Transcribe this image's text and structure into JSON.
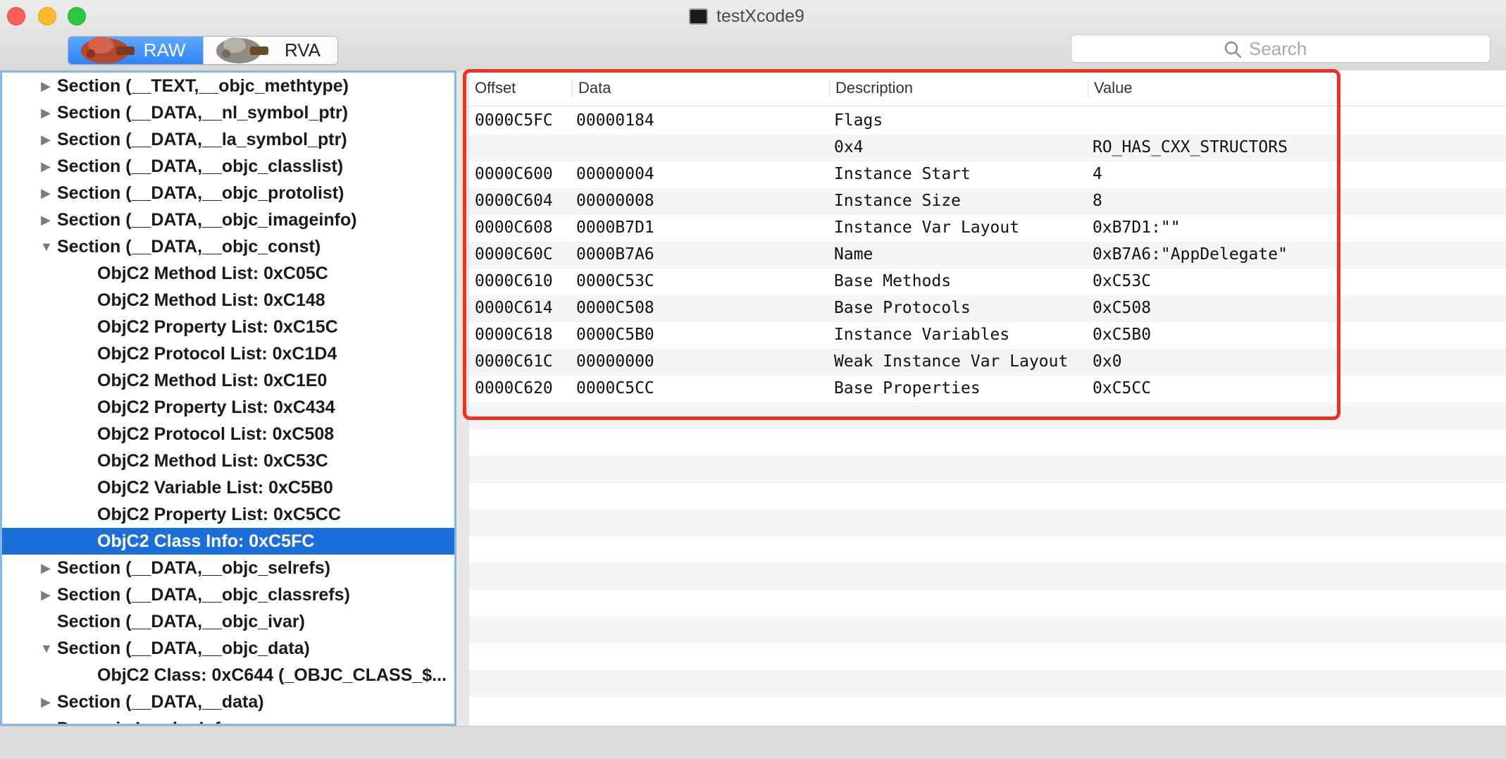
{
  "window": {
    "title": "testXcode9"
  },
  "toolbar": {
    "raw_label": "RAW",
    "rva_label": "RVA",
    "search_placeholder": "Search"
  },
  "tree": [
    {
      "label": "Section (__TEXT,__objc_methtype)",
      "disclosure": "collapsed",
      "level": 0
    },
    {
      "label": "Section (__DATA,__nl_symbol_ptr)",
      "disclosure": "collapsed",
      "level": 0
    },
    {
      "label": "Section (__DATA,__la_symbol_ptr)",
      "disclosure": "collapsed",
      "level": 0
    },
    {
      "label": "Section (__DATA,__objc_classlist)",
      "disclosure": "collapsed",
      "level": 0
    },
    {
      "label": "Section (__DATA,__objc_protolist)",
      "disclosure": "collapsed",
      "level": 0
    },
    {
      "label": "Section (__DATA,__objc_imageinfo)",
      "disclosure": "collapsed",
      "level": 0
    },
    {
      "label": "Section (__DATA,__objc_const)",
      "disclosure": "expanded",
      "level": 0
    },
    {
      "label": "ObjC2 Method List: 0xC05C",
      "disclosure": "none",
      "level": 1
    },
    {
      "label": "ObjC2 Method List: 0xC148",
      "disclosure": "none",
      "level": 1
    },
    {
      "label": "ObjC2 Property List: 0xC15C",
      "disclosure": "none",
      "level": 1
    },
    {
      "label": "ObjC2 Protocol List: 0xC1D4",
      "disclosure": "none",
      "level": 1
    },
    {
      "label": "ObjC2 Method List: 0xC1E0",
      "disclosure": "none",
      "level": 1
    },
    {
      "label": "ObjC2 Property List: 0xC434",
      "disclosure": "none",
      "level": 1
    },
    {
      "label": "ObjC2 Protocol List: 0xC508",
      "disclosure": "none",
      "level": 1
    },
    {
      "label": "ObjC2 Method List: 0xC53C",
      "disclosure": "none",
      "level": 1
    },
    {
      "label": "ObjC2 Variable List: 0xC5B0",
      "disclosure": "none",
      "level": 1
    },
    {
      "label": "ObjC2 Property List: 0xC5CC",
      "disclosure": "none",
      "level": 1
    },
    {
      "label": "ObjC2 Class Info: 0xC5FC",
      "disclosure": "none",
      "level": 1,
      "selected": true
    },
    {
      "label": "Section (__DATA,__objc_selrefs)",
      "disclosure": "collapsed",
      "level": 0
    },
    {
      "label": "Section (__DATA,__objc_classrefs)",
      "disclosure": "collapsed",
      "level": 0
    },
    {
      "label": "Section (__DATA,__objc_ivar)",
      "disclosure": "none",
      "level": 0
    },
    {
      "label": "Section (__DATA,__objc_data)",
      "disclosure": "expanded",
      "level": 0
    },
    {
      "label": "ObjC2 Class: 0xC644 (_OBJC_CLASS_$...",
      "disclosure": "none",
      "level": 1
    },
    {
      "label": "Section (__DATA,__data)",
      "disclosure": "collapsed",
      "level": 0
    },
    {
      "label": "Dynamic Loader Info",
      "disclosure": "collapsed",
      "level": 0
    }
  ],
  "table": {
    "columns": [
      "Offset",
      "Data",
      "Description",
      "Value"
    ],
    "rows": [
      {
        "offset": "0000C5FC",
        "data": "00000184",
        "description": "Flags",
        "value": ""
      },
      {
        "offset": "",
        "data": "",
        "description": "0x4",
        "value": "RO_HAS_CXX_STRUCTORS"
      },
      {
        "offset": "0000C600",
        "data": "00000004",
        "description": "Instance Start",
        "value": "4"
      },
      {
        "offset": "0000C604",
        "data": "00000008",
        "description": "Instance Size",
        "value": "8"
      },
      {
        "offset": "0000C608",
        "data": "0000B7D1",
        "description": "Instance Var Layout",
        "value": "0xB7D1:\"\""
      },
      {
        "offset": "0000C60C",
        "data": "0000B7A6",
        "description": "Name",
        "value": "0xB7A6:\"AppDelegate\""
      },
      {
        "offset": "0000C610",
        "data": "0000C53C",
        "description": "Base Methods",
        "value": "0xC53C"
      },
      {
        "offset": "0000C614",
        "data": "0000C508",
        "description": "Base Protocols",
        "value": "0xC508"
      },
      {
        "offset": "0000C618",
        "data": "0000C5B0",
        "description": "Instance Variables",
        "value": "0xC5B0"
      },
      {
        "offset": "0000C61C",
        "data": "00000000",
        "description": "Weak Instance Var Layout",
        "value": "0x0"
      },
      {
        "offset": "0000C620",
        "data": "0000C5CC",
        "description": "Base Properties",
        "value": "0xC5CC"
      }
    ]
  },
  "colors": {
    "selection": "#1c6fd9",
    "annotation_border": "#ea3323",
    "sidebar_focus_border": "#86b5e7"
  }
}
